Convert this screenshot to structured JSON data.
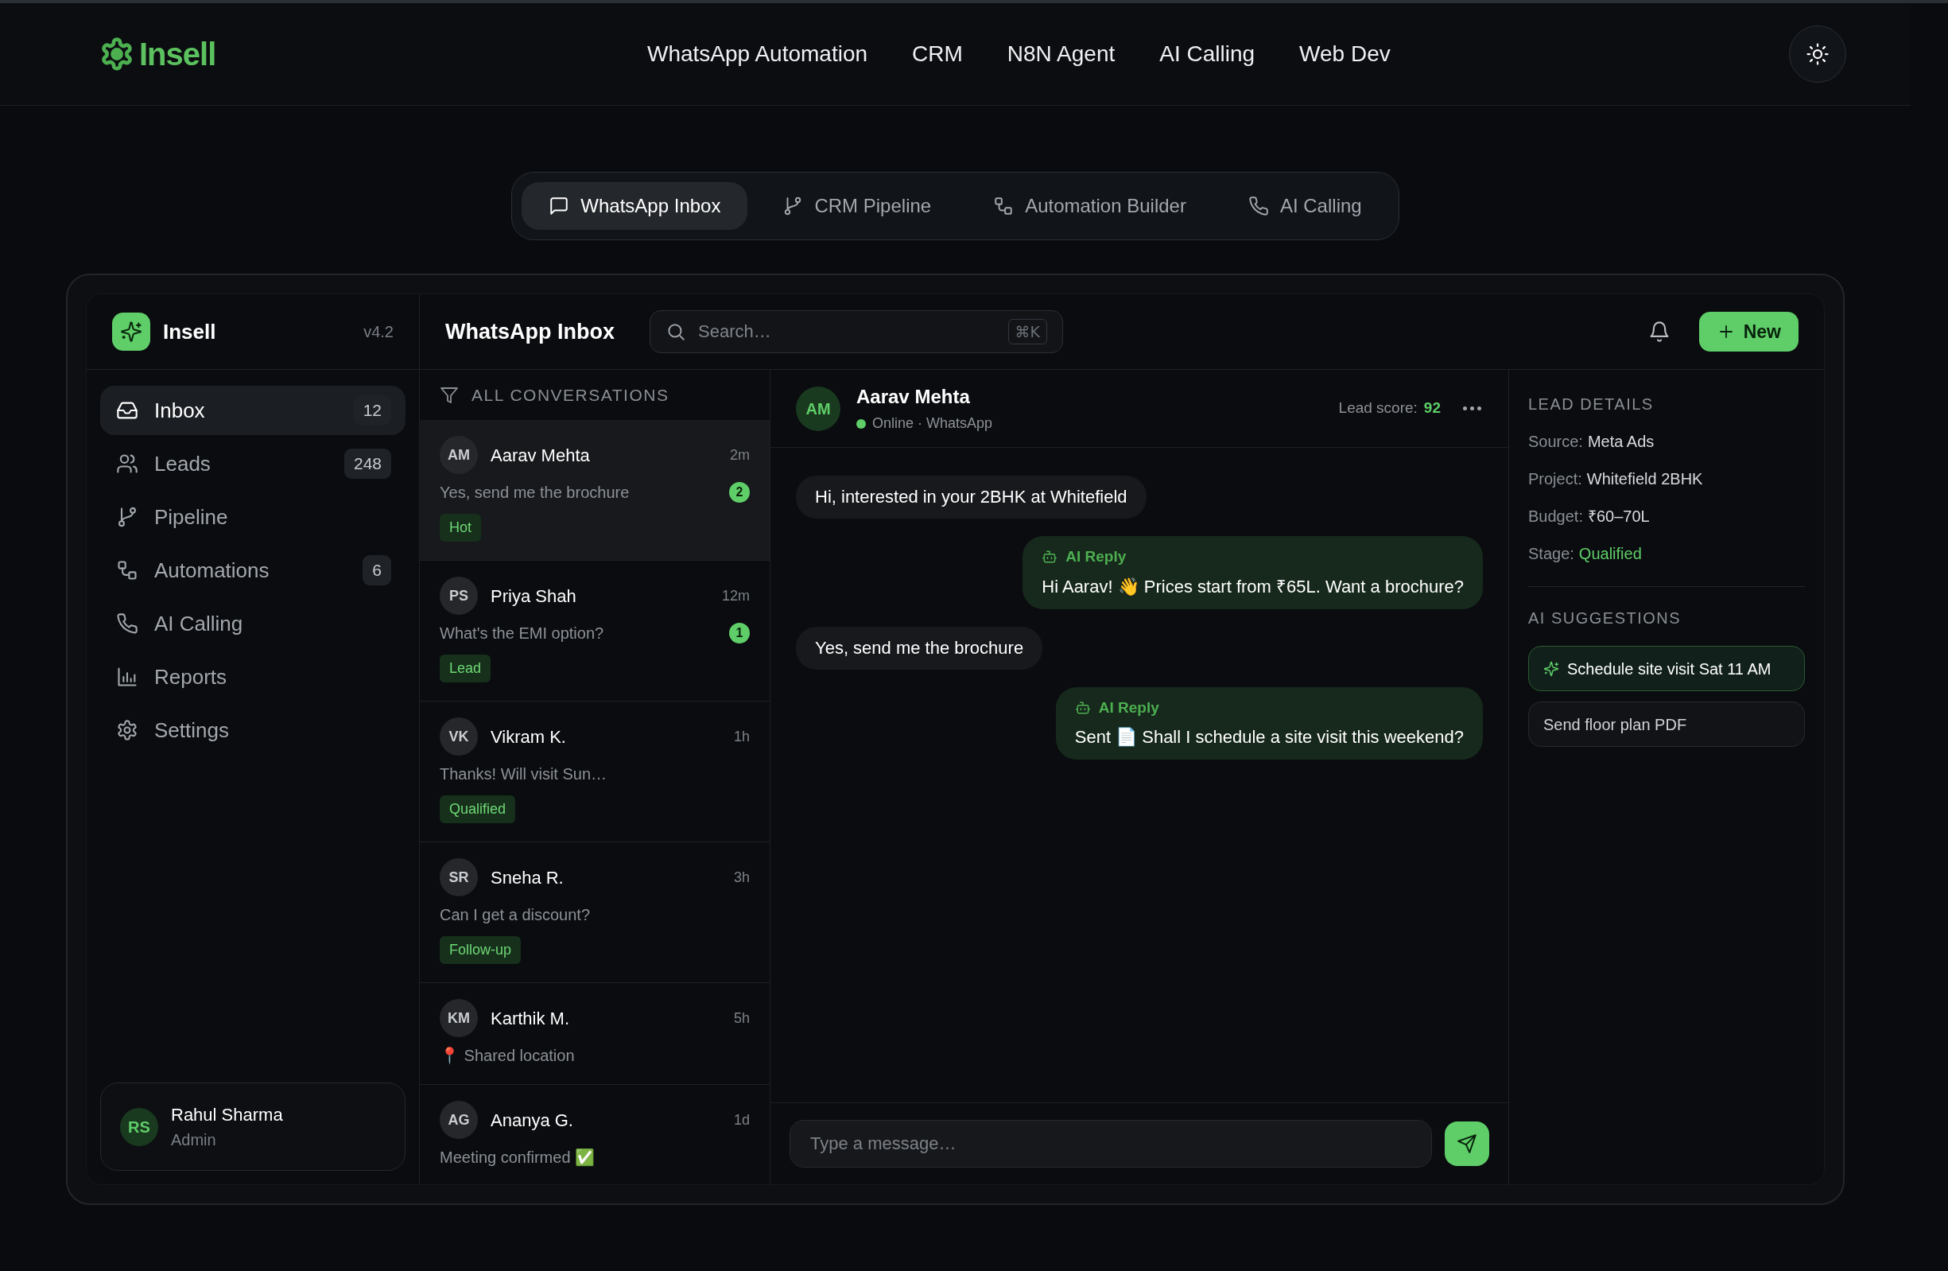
{
  "top_nav": {
    "brand": "Insell",
    "links": [
      "WhatsApp Automation",
      "CRM",
      "N8N Agent",
      "AI Calling",
      "Web Dev"
    ]
  },
  "demo_tabs": [
    {
      "label": "WhatsApp Inbox",
      "selected": true
    },
    {
      "label": "CRM Pipeline",
      "selected": false
    },
    {
      "label": "Automation Builder",
      "selected": false
    },
    {
      "label": "AI Calling",
      "selected": false
    }
  ],
  "sidebar": {
    "brand": "Insell",
    "version": "v4.2",
    "items": [
      {
        "label": "Inbox",
        "count": "12",
        "selected": true
      },
      {
        "label": "Leads",
        "count": "248",
        "selected": false
      },
      {
        "label": "Pipeline",
        "selected": false
      },
      {
        "label": "Automations",
        "count": "6",
        "selected": false
      },
      {
        "label": "AI Calling",
        "selected": false
      },
      {
        "label": "Reports",
        "selected": false
      },
      {
        "label": "Settings",
        "selected": false
      }
    ],
    "user": {
      "initials": "RS",
      "name": "Rahul Sharma",
      "role": "Admin"
    }
  },
  "header": {
    "title": "WhatsApp Inbox",
    "search_placeholder": "Search…",
    "shortcut": "⌘K",
    "new_button": "New"
  },
  "conversations": {
    "heading": "ALL CONVERSATIONS",
    "items": [
      {
        "initials": "AM",
        "name": "Aarav Mehta",
        "time": "2m",
        "preview": "Yes, send me the brochure",
        "unread": "2",
        "tag": "Hot",
        "selected": true
      },
      {
        "initials": "PS",
        "name": "Priya Shah",
        "time": "12m",
        "preview": "What's the EMI option?",
        "unread": "1",
        "tag": "Lead",
        "selected": false
      },
      {
        "initials": "VK",
        "name": "Vikram K.",
        "time": "1h",
        "preview": "Thanks! Will visit Sun…",
        "tag": "Qualified",
        "selected": false
      },
      {
        "initials": "SR",
        "name": "Sneha R.",
        "time": "3h",
        "preview": "Can I get a discount?",
        "tag": "Follow-up",
        "selected": false
      },
      {
        "initials": "KM",
        "name": "Karthik M.",
        "time": "5h",
        "preview": "📍 Shared location",
        "selected": false
      },
      {
        "initials": "AG",
        "name": "Ananya G.",
        "time": "1d",
        "preview": "Meeting confirmed ✅",
        "selected": false
      }
    ]
  },
  "chat": {
    "initials": "AM",
    "name": "Aarav Mehta",
    "online": true,
    "status": "Online · WhatsApp",
    "score_label": "Lead score:",
    "score": "92",
    "messages": [
      {
        "kind": "incoming",
        "text": "Hi, interested in your 2BHK at Whitefield"
      },
      {
        "kind": "ai",
        "label": "AI Reply",
        "text": "Hi Aarav! 👋 Prices start from ₹65L. Want a brochure?"
      },
      {
        "kind": "incoming",
        "text": "Yes, send me the brochure"
      },
      {
        "kind": "ai",
        "label": "AI Reply",
        "text": "Sent 📄 Shall I schedule a site visit this weekend?"
      }
    ],
    "compose_placeholder": "Type a message…"
  },
  "lead_details": {
    "heading": "LEAD DETAILS",
    "fields": [
      {
        "label": "Source:",
        "value": "Meta Ads",
        "highlight": false
      },
      {
        "label": "Project:",
        "value": "Whitefield 2BHK",
        "highlight": false
      },
      {
        "label": "Budget:",
        "value": "₹60–70L",
        "highlight": false
      },
      {
        "label": "Stage:",
        "value": "Qualified",
        "highlight": true
      }
    ],
    "suggestions_heading": "AI SUGGESTIONS",
    "suggestions": [
      {
        "text": "Schedule site visit Sat 11 AM",
        "highlighted": true
      },
      {
        "text": "Send floor plan PDF",
        "highlighted": false
      }
    ]
  }
}
